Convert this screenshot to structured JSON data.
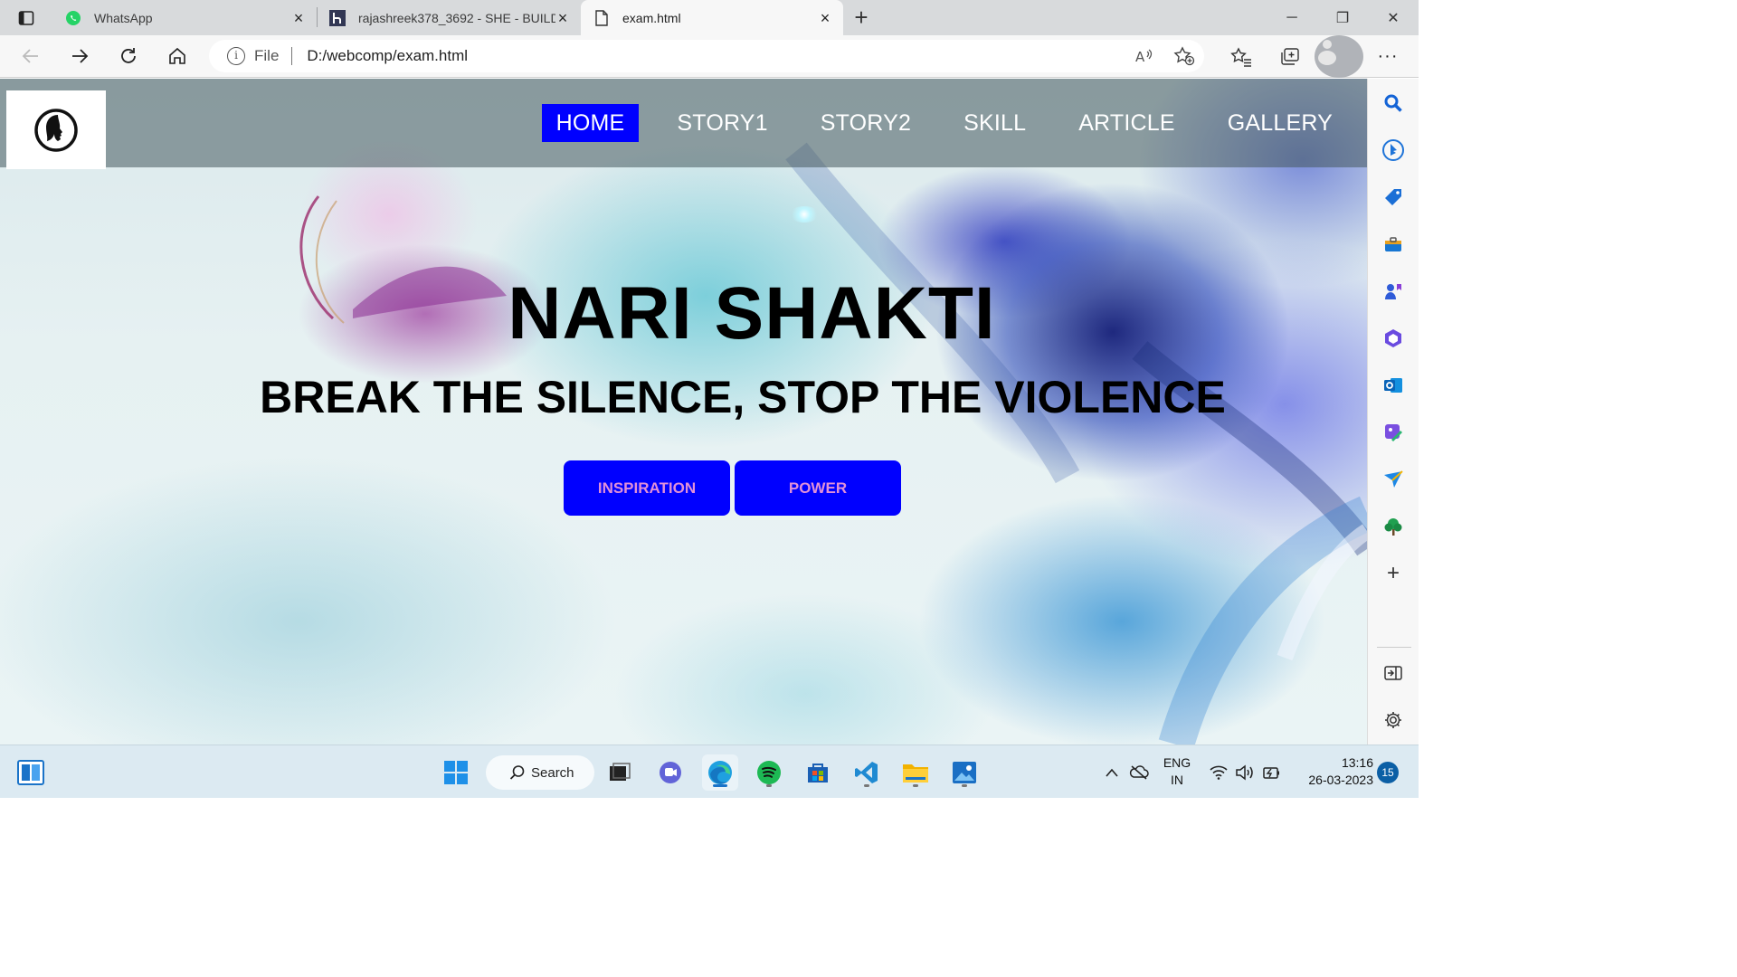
{
  "browser": {
    "tabs": [
      {
        "title": "WhatsApp",
        "active": false,
        "icon": "whatsapp-icon"
      },
      {
        "title": "rajashreek378_3692 - SHE - BUILD",
        "active": false,
        "icon": "hackerearth-icon"
      },
      {
        "title": "exam.html",
        "active": true,
        "icon": "document-icon"
      }
    ],
    "address": {
      "scheme": "File",
      "url": "D:/webcomp/exam.html"
    }
  },
  "page": {
    "nav": {
      "items": [
        {
          "label": "HOME",
          "active": true
        },
        {
          "label": "STORY1",
          "active": false
        },
        {
          "label": "STORY2",
          "active": false
        },
        {
          "label": "SKILL",
          "active": false
        },
        {
          "label": "ARTICLE",
          "active": false
        },
        {
          "label": "GALLERY",
          "active": false
        }
      ],
      "active_color": "#0000ff"
    },
    "hero": {
      "title": "NARI SHAKTI",
      "subtitle": "BREAK THE SILENCE, STOP THE VIOLENCE",
      "buttons": [
        {
          "label": "INSPIRATION"
        },
        {
          "label": "POWER"
        }
      ],
      "button_color": "#0000ff",
      "button_text_color": "#e090d8"
    }
  },
  "taskbar": {
    "search_label": "Search",
    "language": {
      "line1": "ENG",
      "line2": "IN"
    },
    "clock": {
      "time": "13:16",
      "date": "26-03-2023"
    },
    "notification_count": "15"
  }
}
